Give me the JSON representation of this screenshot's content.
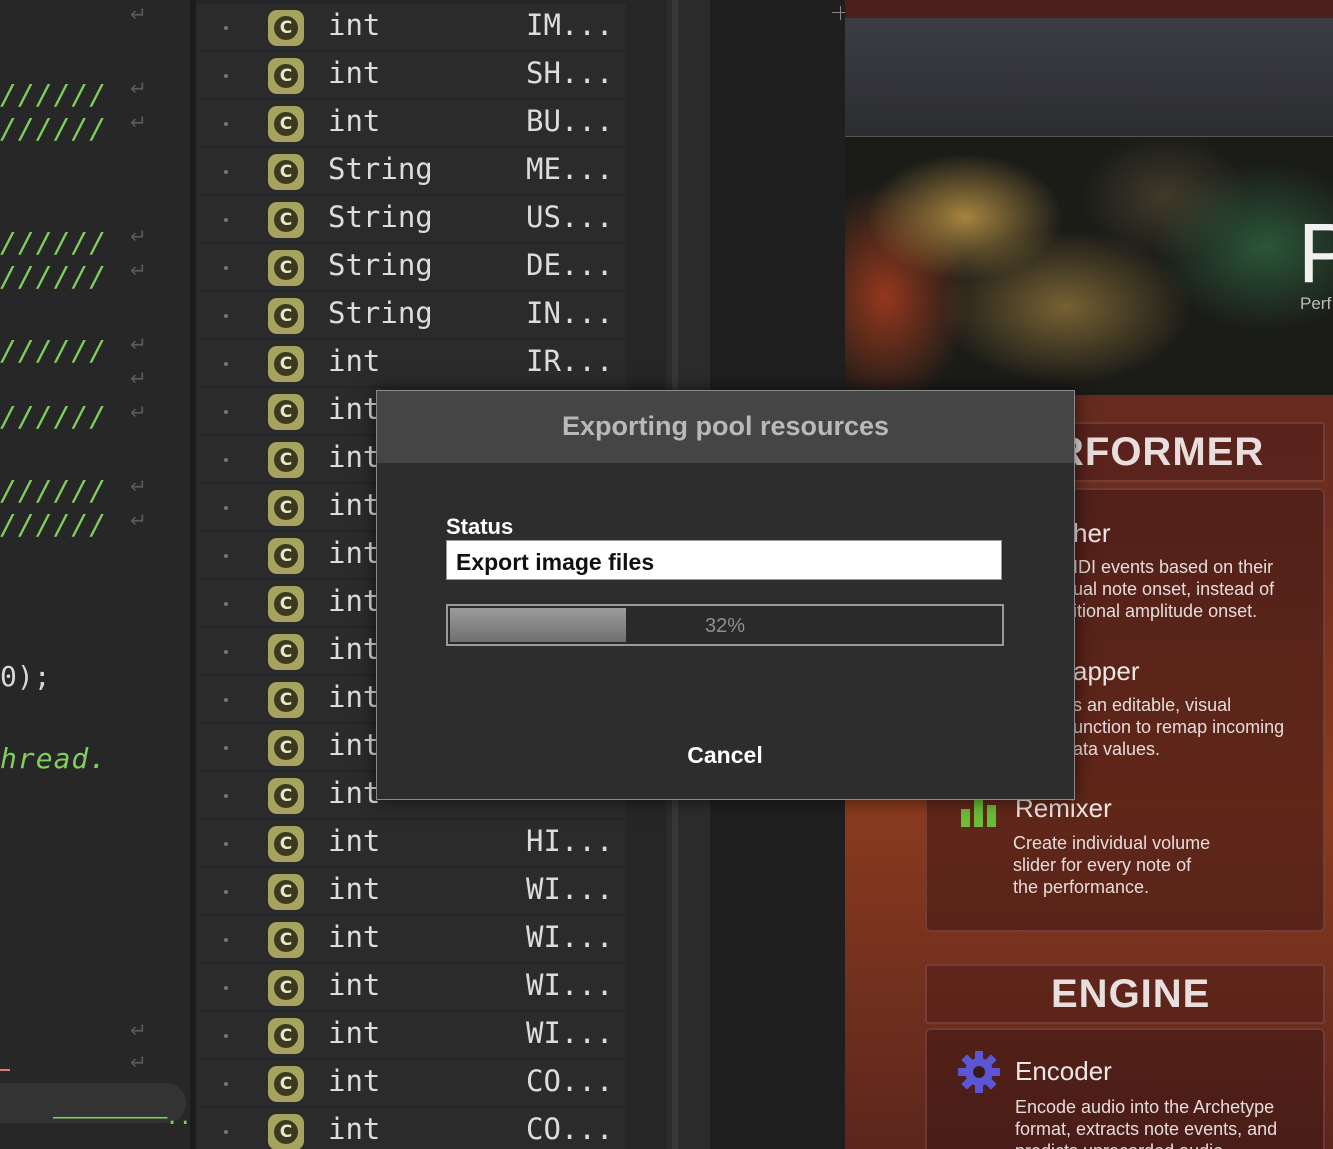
{
  "code_editor": {
    "comment_fragment": "//////",
    "code_call_fragment": "0);",
    "comment_word": "hread.",
    "ellipsis": "..."
  },
  "structure": {
    "rows": [
      {
        "icon": "C",
        "type": "int",
        "name": "IM..."
      },
      {
        "icon": "C",
        "type": "int",
        "name": "SH..."
      },
      {
        "icon": "C",
        "type": "int",
        "name": "BU..."
      },
      {
        "icon": "C",
        "type": "String",
        "name": "ME..."
      },
      {
        "icon": "C",
        "type": "String",
        "name": "US..."
      },
      {
        "icon": "C",
        "type": "String",
        "name": "DE..."
      },
      {
        "icon": "C",
        "type": "String",
        "name": "IN..."
      },
      {
        "icon": "C",
        "type": "int",
        "name": "IR..."
      },
      {
        "icon": "C",
        "type": "int",
        "name": ""
      },
      {
        "icon": "C",
        "type": "int",
        "name": ""
      },
      {
        "icon": "C",
        "type": "int",
        "name": ""
      },
      {
        "icon": "C",
        "type": "int",
        "name": ""
      },
      {
        "icon": "C",
        "type": "int",
        "name": ""
      },
      {
        "icon": "C",
        "type": "int",
        "name": ""
      },
      {
        "icon": "C",
        "type": "int",
        "name": ""
      },
      {
        "icon": "C",
        "type": "int",
        "name": ""
      },
      {
        "icon": "C",
        "type": "int",
        "name": ""
      },
      {
        "icon": "C",
        "type": "int",
        "name": "HI..."
      },
      {
        "icon": "C",
        "type": "int",
        "name": "WI..."
      },
      {
        "icon": "C",
        "type": "int",
        "name": "WI..."
      },
      {
        "icon": "C",
        "type": "int",
        "name": "WI..."
      },
      {
        "icon": "C",
        "type": "int",
        "name": "WI..."
      },
      {
        "icon": "C",
        "type": "int",
        "name": "CO..."
      },
      {
        "icon": "C",
        "type": "int",
        "name": "CO..."
      }
    ]
  },
  "preview": {
    "hero_letter": "P",
    "hero_subtitle": "Perf",
    "performer_header": "RFORMER",
    "feature1_title": "her",
    "feature1_desc": "IDI events based on their\nual note onset, instead of\nitional amplitude onset.",
    "feature2_title": "apper",
    "feature2_desc": "s an editable, visual\nunction to remap incoming\nata values.",
    "remixer_title": "Remixer",
    "remixer_desc": "Create individual volume\nslider for every note of\nthe performance.",
    "engine_header": "ENGINE",
    "encoder_title": "Encoder",
    "encoder_desc": "Encode audio into the Archetype\nformat, extracts note events, and\npredicts unrecorded audio"
  },
  "dialog": {
    "title": "Exporting pool resources",
    "status_label": "Status",
    "status_value": "Export image files",
    "progress_percent": 32,
    "progress_label": "32%",
    "cancel_label": "Cancel"
  },
  "colors": {
    "class_icon": "#a6a35e",
    "comment_green": "#7fcf5e",
    "remixer_green": "#6bbd3a",
    "encoder_blue": "#5b56d6"
  }
}
